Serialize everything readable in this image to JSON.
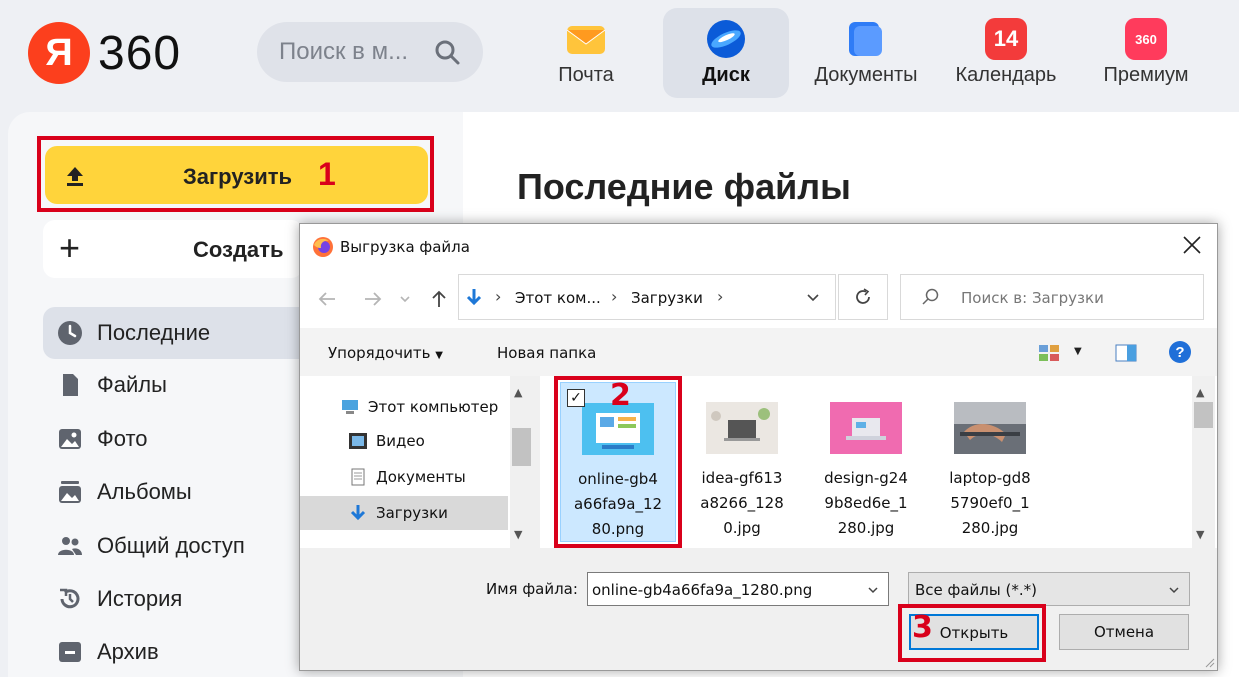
{
  "header": {
    "logo_letter": "Я",
    "logo_text": "360",
    "search_placeholder": "Поиск в м...",
    "apps": [
      {
        "label": "Почта",
        "icon": "mail-icon",
        "color": "#ffb22b"
      },
      {
        "label": "Диск",
        "icon": "disk-icon",
        "color": "#1d64e0"
      },
      {
        "label": "Документы",
        "icon": "documents-icon",
        "color": "#2f7cf6"
      },
      {
        "label": "Календарь",
        "icon": "calendar-icon",
        "badge": "14",
        "color": "#f33b3b"
      },
      {
        "label": "Премиум",
        "icon": "premium-icon",
        "badge": "360",
        "color": "#ff3b5c"
      }
    ]
  },
  "sidebar": {
    "upload_label": "Загрузить",
    "create_label": "Создать",
    "items": [
      {
        "label": "Последние",
        "icon": "clock-icon",
        "active": true
      },
      {
        "label": "Файлы",
        "icon": "file-icon"
      },
      {
        "label": "Фото",
        "icon": "photo-icon"
      },
      {
        "label": "Альбомы",
        "icon": "albums-icon"
      },
      {
        "label": "Общий доступ",
        "icon": "shared-icon"
      },
      {
        "label": "История",
        "icon": "history-icon"
      },
      {
        "label": "Архив",
        "icon": "archive-icon"
      }
    ]
  },
  "main": {
    "title": "Последние файлы"
  },
  "markers": {
    "one": "1",
    "two": "2",
    "three": "3"
  },
  "dialog": {
    "title": "Выгрузка файла",
    "path": [
      "Этот ком...",
      "Загрузки"
    ],
    "search_placeholder": "Поиск в: Загрузки",
    "toolbar": {
      "organize": "Упорядочить",
      "new_folder": "Новая папка"
    },
    "tree": [
      {
        "label": "Этот компьютер",
        "icon": "computer-icon"
      },
      {
        "label": "Видео",
        "icon": "video-folder-icon"
      },
      {
        "label": "Документы",
        "icon": "documents-folder-icon"
      },
      {
        "label": "Загрузки",
        "icon": "downloads-folder-icon",
        "selected": true
      }
    ],
    "files": [
      {
        "name_lines": [
          "online-gb4",
          "a66fa9a_12",
          "80.png"
        ],
        "selected": true,
        "thumb_color": "#4dc0f0"
      },
      {
        "name_lines": [
          "idea-gf613",
          "a8266_128",
          "0.jpg"
        ],
        "thumb_color": "#e8e4df"
      },
      {
        "name_lines": [
          "design-g24",
          "9b8ed6e_1",
          "280.jpg"
        ],
        "thumb_color": "#f06bb0"
      },
      {
        "name_lines": [
          "laptop-gd8",
          "5790ef0_1",
          "280.jpg"
        ],
        "thumb_color": "#8a8f96"
      }
    ],
    "filename_label": "Имя файла:",
    "filename_value": "online-gb4a66fa9a_1280.png",
    "filetype_value": "Все файлы (*.*)",
    "open_label": "Открыть",
    "cancel_label": "Отмена"
  }
}
